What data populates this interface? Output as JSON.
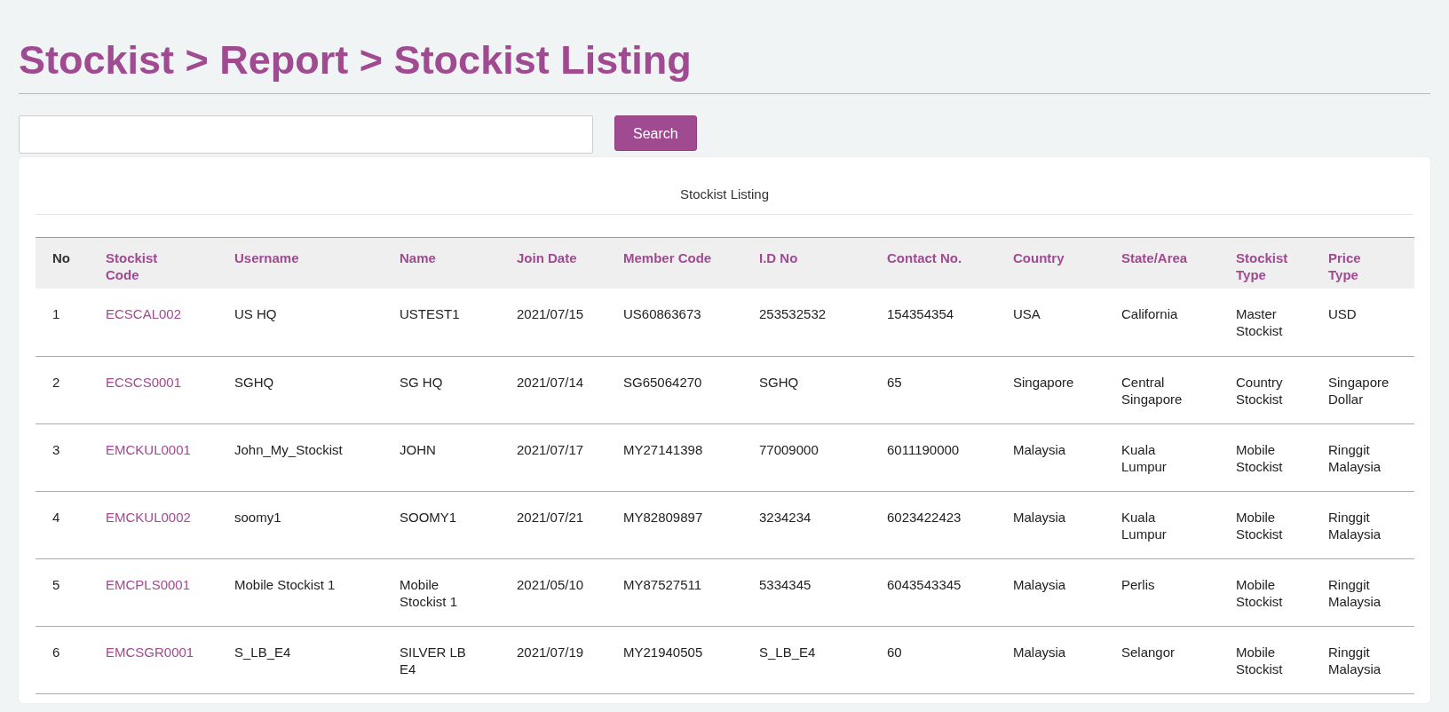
{
  "page_title": "Stockist > Report > Stockist Listing",
  "search": {
    "button": "Search"
  },
  "table": {
    "caption": "Stockist Listing",
    "columns": [
      "No",
      "Stockist Code",
      "Username",
      "Name",
      "Join Date",
      "Member Code",
      "I.D No",
      "Contact No.",
      "Country",
      "State/Area",
      "Stockist Type",
      "Price Type"
    ],
    "rows": [
      [
        "1",
        "ECSCAL002",
        "US HQ",
        "USTEST1",
        "2021/07/15",
        "US60863673",
        "253532532",
        "154354354",
        "USA",
        "California",
        "Master Stockist",
        "USD"
      ],
      [
        "2",
        "ECSCS0001",
        "SGHQ",
        "SG HQ",
        "2021/07/14",
        "SG65064270",
        "SGHQ",
        "65",
        "Singapore",
        "Central Singapore",
        "Country Stockist",
        "Singapore Dollar"
      ],
      [
        "3",
        "EMCKUL0001",
        "John_My_Stockist",
        "JOHN",
        "2021/07/17",
        "MY27141398",
        "77009000",
        "6011190000",
        "Malaysia",
        "Kuala Lumpur",
        "Mobile Stockist",
        "Ringgit Malaysia"
      ],
      [
        "4",
        "EMCKUL0002",
        "soomy1",
        "SOOMY1",
        "2021/07/21",
        "MY82809897",
        "3234234",
        "6023422423",
        "Malaysia",
        "Kuala Lumpur",
        "Mobile Stockist",
        "Ringgit Malaysia"
      ],
      [
        "5",
        "EMCPLS0001",
        "Mobile Stockist 1",
        "Mobile Stockist 1",
        "2021/05/10",
        "MY87527511",
        "5334345",
        "6043543345",
        "Malaysia",
        "Perlis",
        "Mobile Stockist",
        "Ringgit Malaysia"
      ],
      [
        "6",
        "EMCSGR0001",
        "S_LB_E4",
        "SILVER LB E4",
        "2021/07/19",
        "MY21940505",
        "S_LB_E4",
        "60",
        "Malaysia",
        "Selangor",
        "Mobile Stockist",
        "Ringgit Malaysia"
      ]
    ]
  }
}
